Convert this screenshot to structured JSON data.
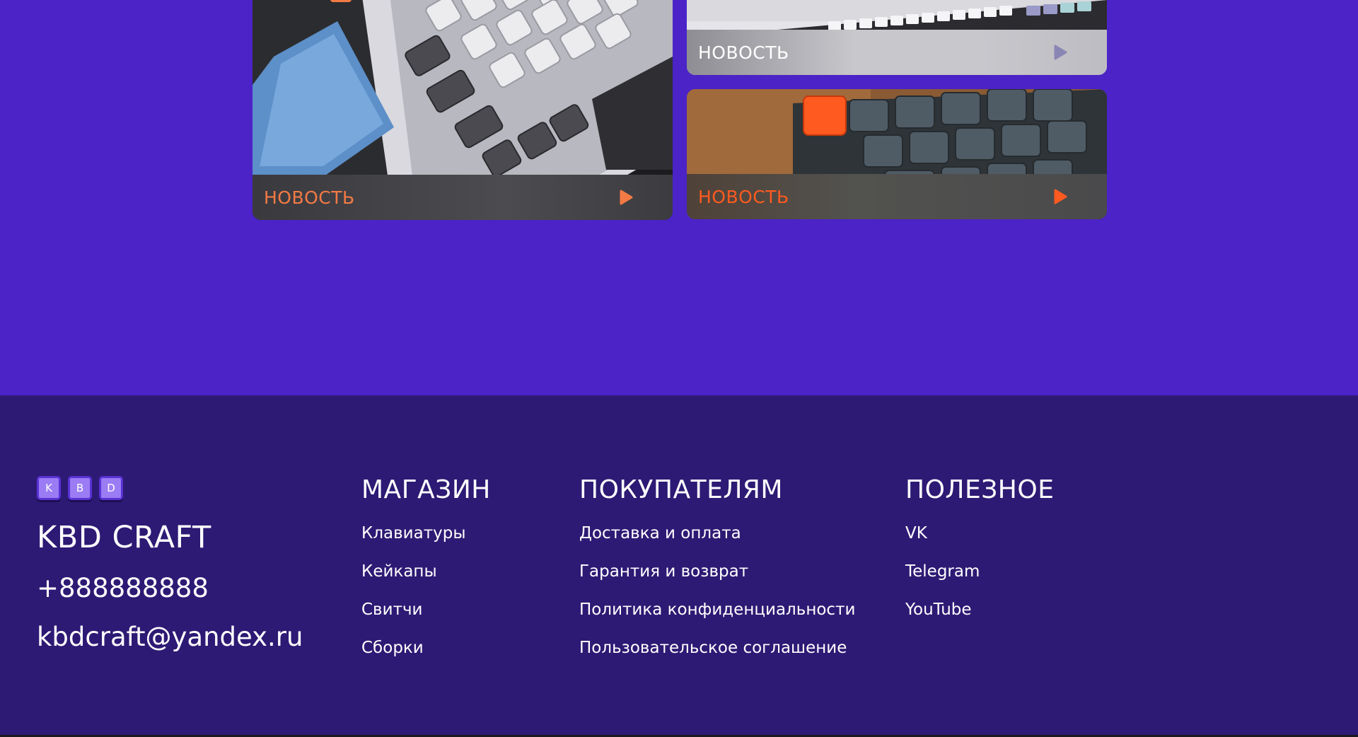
{
  "news": {
    "cards": [
      {
        "label": "НОВОСТЬ",
        "label_color": "#f47a45",
        "image": "keyboard-with-ssd-photo"
      },
      {
        "label": "НОВОСТЬ",
        "label_color": "#ffffff",
        "image": "white-keyboard-photo"
      },
      {
        "label": "НОВОСТЬ",
        "label_color": "#ff5a1f",
        "image": "dark-keyboard-orange-esc-photo"
      }
    ],
    "icon": "play-icon"
  },
  "footer": {
    "logo_keys": [
      "K",
      "B",
      "D"
    ],
    "brand": "KBD CRAFT",
    "phone": "+888888888",
    "email": "kbdcraft@yandex.ru",
    "columns": {
      "shop": {
        "title": "МАГАЗИН",
        "links": [
          "Клавиатуры",
          "Кейкапы",
          "Свитчи",
          "Сборки"
        ]
      },
      "buyers": {
        "title": "ПОКУПАТЕЛЯМ",
        "links": [
          "Доставка и оплата",
          "Гарантия и возврат",
          "Политика конфиденциальности",
          "Пользовательское соглашение"
        ]
      },
      "useful": {
        "title": "ПОЛЕЗНОЕ",
        "links": [
          "VK",
          "Telegram",
          "YouTube"
        ]
      }
    }
  },
  "colors": {
    "news_bg": "#4b23c6",
    "footer_bg": "#2d1a74",
    "accent_orange": "#ff5a1f",
    "key_purple": "#9c7cf4"
  }
}
